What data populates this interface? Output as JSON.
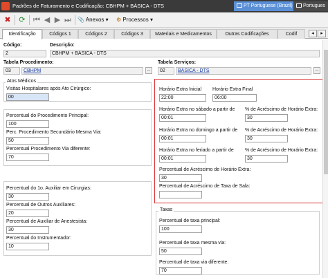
{
  "window": {
    "title": "Padrões de Faturamento e Codificação: CBHPM + BÁSICA - DTS",
    "language_primary": "PT Portuguese (Brazil)",
    "language_secondary": "Portugues"
  },
  "toolbar": {
    "anexos_label": "Anexos",
    "processos_label": "Processos"
  },
  "tabs": [
    "Identificação",
    "Códigos 1",
    "Códigos 2",
    "Códigos 3",
    "Materiais e Medicamentos",
    "Outras Codificações",
    "Codif"
  ],
  "header": {
    "codigo_label": "Código:",
    "codigo_value": "2",
    "descricao_label": "Descrição:",
    "descricao_value": "CBHPM + BÁSICA - DTS",
    "tabela_procedimento_label": "Tabela Procedimento:",
    "tabela_procedimento_code": "03",
    "tabela_procedimento_name": "CBHPM",
    "tabela_servicos_label": "Tabela Serviços:",
    "tabela_servicos_code": "02",
    "tabela_servicos_name": "BÁSICA - DTS",
    "dots_label": "..."
  },
  "atos_medicos": {
    "group_title": "Atos Médicos",
    "visitas_label": "Visitas Hospitalares  após Ato Cirúrgico:",
    "visitas_value": "00"
  },
  "procedimentos": {
    "principal_label": "Percentual do Procedimento Principal:",
    "principal_value": "100",
    "secundario_label": "Perc. Procedimento Secundário Mesma Via:",
    "secundario_value": "50",
    "via_diferente_label": "Percentual Procedimento Via diferente:",
    "via_diferente_value": "70"
  },
  "horario_extra": {
    "inicial_label": "Horário Extra Inicial",
    "inicial_value": "22:00",
    "final_label": "Horário Extra Final",
    "final_value": "06:00",
    "sabado_label": "Horário Extra no sábado a partir de",
    "sabado_value": "00:01",
    "sabado_perc_label": "% de Acréscimo de Horário Extra:",
    "sabado_perc_value": "30",
    "domingo_label": "Horário Extra no domingo a partir de",
    "domingo_value": "00:01",
    "domingo_perc_label": "% de Acréscimo de Horário Extra:",
    "domingo_perc_value": "30",
    "feriado_label": "Horário Extra no feriado a partir de",
    "feriado_value": "00:01",
    "feriado_perc_label": "% de Acréscimo de Horário Extra:",
    "feriado_perc_value": "30",
    "acrescimo_label": "Percentual de Acréscimo de Horário Extra:",
    "acrescimo_value": "30",
    "taxa_sala_label": "Percentual de Acréscimo de Taxa de Sala:",
    "taxa_sala_value": ""
  },
  "auxiliares": {
    "primeiro_label": "Percentual do 1o. Auxiliar em Cirurgias:",
    "primeiro_value": "30",
    "outros_label": "Percentual de Outros Auxiliares:",
    "outros_value": "20",
    "anestesista_label": "Percentual de Auxiliar de Anestesista:",
    "anestesista_value": "30",
    "instrumentador_label": "Percentual do Instrumentador:",
    "instrumentador_value": "10"
  },
  "taxas": {
    "group_title": "Taxas",
    "principal_label": "Percentual de taxa principal:",
    "principal_value": "100",
    "mesma_via_label": "Percentual de taxa mesma via:",
    "mesma_via_value": "50",
    "via_diferente_label": "Percentual de taxa via diferente:",
    "via_diferente_value": "70"
  },
  "colors": {
    "highlight_border": "#d93030",
    "link": "#1a3ea8",
    "titlebar": "#3a3a3a"
  }
}
